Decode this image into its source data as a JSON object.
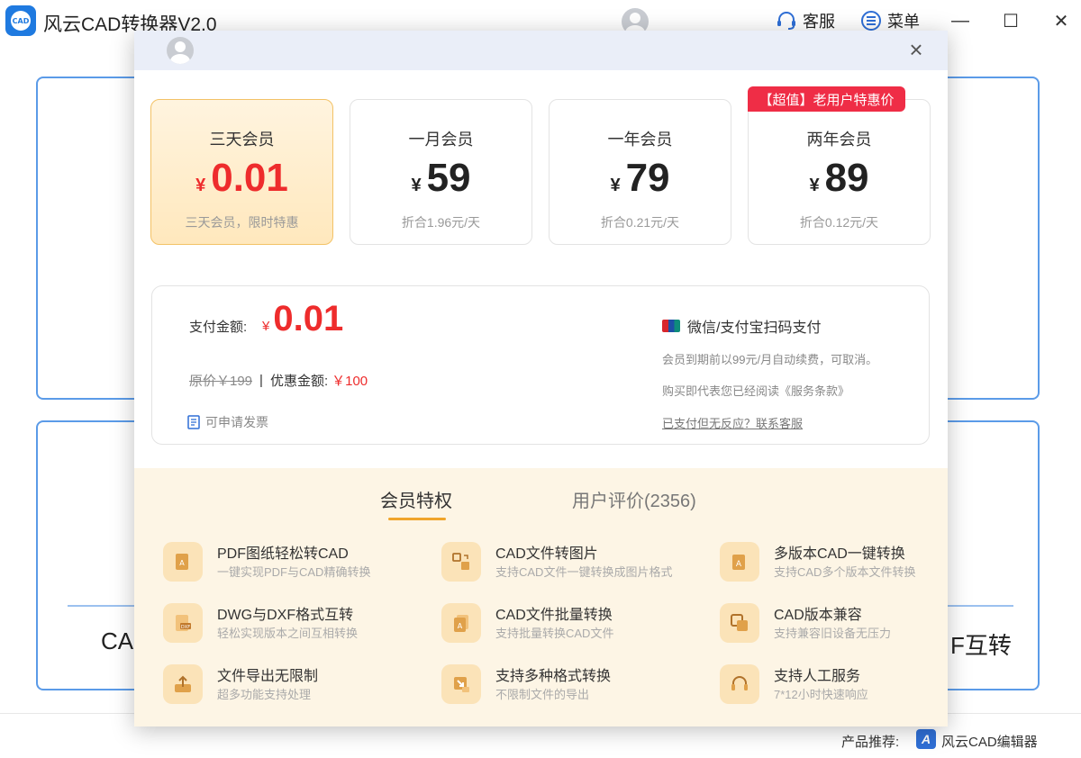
{
  "app": {
    "title": "风云CAD转换器V2.0",
    "logo_text": "CAD",
    "service_label": "客服",
    "menu_label": "菜单",
    "minimize": "—",
    "maximize": "☐",
    "close": "✕"
  },
  "background": {
    "left_text": "CA",
    "right_text": "F互转"
  },
  "footer": {
    "product_label": "产品推荐:",
    "product_logo": "A",
    "product_name": "风云CAD编辑器"
  },
  "modal": {
    "close": "×",
    "badge": "【超值】老用户特惠价",
    "plans": [
      {
        "name": "三天会员",
        "currency": "¥",
        "price": "0.01",
        "sub": "三天会员，限时特惠",
        "selected": true
      },
      {
        "name": "一月会员",
        "currency": "¥",
        "price": "59",
        "sub": "折合1.96元/天",
        "selected": false
      },
      {
        "name": "一年会员",
        "currency": "¥",
        "price": "79",
        "sub": "折合0.21元/天",
        "selected": false
      },
      {
        "name": "两年会员",
        "currency": "¥",
        "price": "89",
        "sub": "折合0.12元/天",
        "selected": false
      }
    ],
    "payment": {
      "label": "支付金额:",
      "currency": "¥",
      "amount": "0.01",
      "original": "原价￥199",
      "separator": "|",
      "discount_label": "优惠金额:",
      "discount_value": "￥100",
      "invoice": "可申请发票",
      "method": "微信/支付宝扫码支付",
      "renew_note": "会员到期前以99元/月自动续费，可取消。",
      "terms": "购买即代表您已经阅读《服务条款》",
      "support_link": "已支付但无反应？联系客服"
    },
    "tabs": {
      "active": "会员特权",
      "inactive": "用户评价(2356)"
    },
    "perks": [
      {
        "title": "PDF图纸轻松转CAD",
        "desc": "一键实现PDF与CAD精确转换",
        "icon": "pdf-to-cad-icon"
      },
      {
        "title": "CAD文件转图片",
        "desc": "支持CAD文件一键转换成图片格式",
        "icon": "cad-to-image-icon"
      },
      {
        "title": "多版本CAD一键转换",
        "desc": "支持CAD多个版本文件转换",
        "icon": "multi-version-icon"
      },
      {
        "title": "DWG与DXF格式互转",
        "desc": "轻松实现版本之间互相转换",
        "icon": "dwg-dxf-icon"
      },
      {
        "title": "CAD文件批量转换",
        "desc": "支持批量转换CAD文件",
        "icon": "batch-convert-icon"
      },
      {
        "title": "CAD版本兼容",
        "desc": "支持兼容旧设备无压力",
        "icon": "compat-icon"
      },
      {
        "title": "文件导出无限制",
        "desc": "超多功能支持处理",
        "icon": "export-icon"
      },
      {
        "title": "支持多种格式转换",
        "desc": "不限制文件的导出",
        "icon": "formats-icon"
      },
      {
        "title": "支持人工服务",
        "desc": "7*12小时快速响应",
        "icon": "headset-icon"
      }
    ]
  }
}
